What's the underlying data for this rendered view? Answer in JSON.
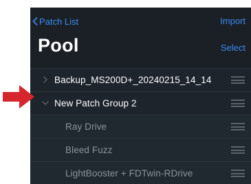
{
  "nav": {
    "back_label": "Patch List",
    "import_label": "Import"
  },
  "header": {
    "title": "Pool",
    "select_label": "Select"
  },
  "rows": [
    {
      "label": "Backup_MS200D+_20240215_14_14",
      "expanded": false,
      "level": 0
    },
    {
      "label": "New Patch Group 2",
      "expanded": true,
      "level": 0
    },
    {
      "label": "Ray Drive",
      "level": 1
    },
    {
      "label": "Bleed Fuzz",
      "level": 1
    },
    {
      "label": "LightBooster + FDTwin-RDrive",
      "level": 1
    }
  ],
  "colors": {
    "accent": "#3a8cf0",
    "background": "#1b2026",
    "annotation_arrow": "#d7262b"
  }
}
